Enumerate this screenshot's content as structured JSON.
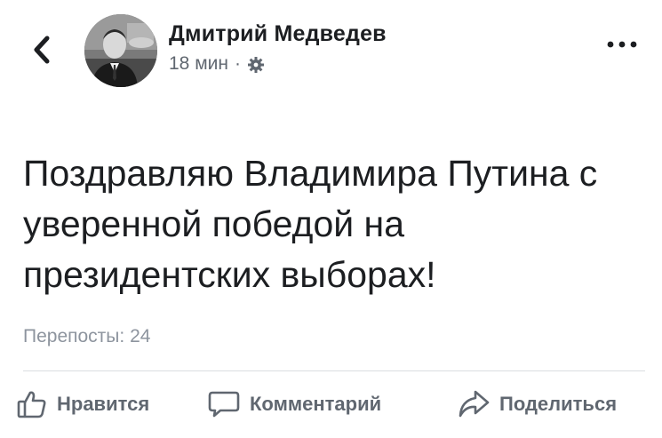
{
  "post": {
    "author": "Дмитрий Медведев",
    "time": "18 мин",
    "separator": "·",
    "audience_icon": "gear-icon",
    "text": "Поздравляю Владимира Путина с уверенной победой на президентских выборах!",
    "reposts": "Перепосты: 24"
  },
  "actions": {
    "like_label": "Нравится",
    "comment_label": "Комментарий",
    "share_label": "Поделиться"
  },
  "icons": {
    "back": "chevron-left-icon",
    "more": "more-dots-icon",
    "like": "thumbs-up-icon",
    "comment": "comment-bubble-icon",
    "share": "share-arrow-icon"
  },
  "colors": {
    "text": "#1c1e21",
    "secondary": "#606770",
    "muted": "#8d949e",
    "divider": "#dadde1"
  }
}
